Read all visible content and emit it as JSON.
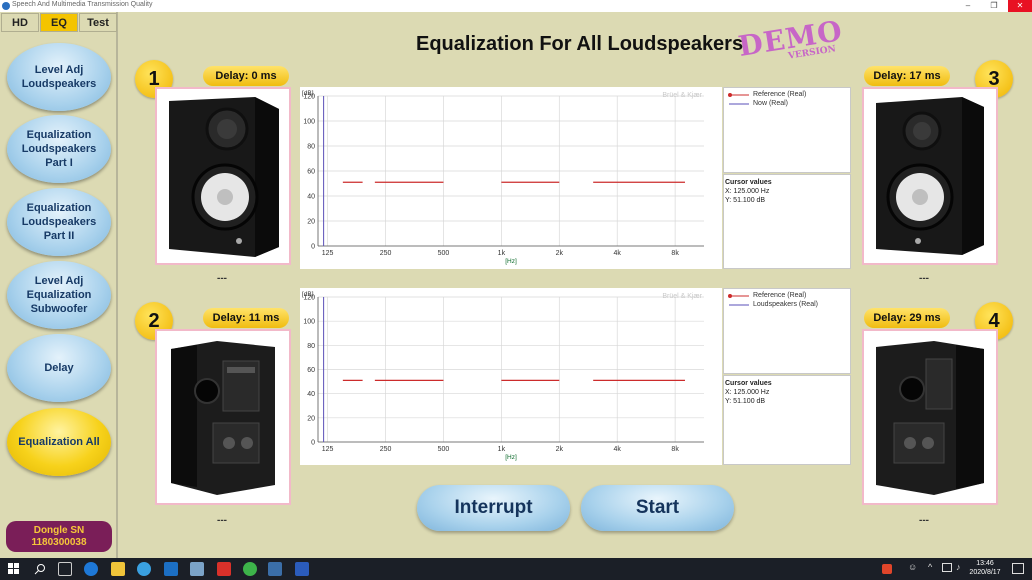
{
  "window": {
    "title": "Speech And Multimedia Transmission Quality",
    "min": "–",
    "max": "❐",
    "close": "✕"
  },
  "tabs": [
    {
      "label": "HD"
    },
    {
      "label": "EQ"
    },
    {
      "label": "Test"
    }
  ],
  "sidebar": {
    "items": [
      {
        "label": "Level Adj Loudspeakers"
      },
      {
        "label": "Equalization Loudspeakers Part I"
      },
      {
        "label": "Equalization Loudspeakers Part II"
      },
      {
        "label": "Level Adj Equalization Subwoofer"
      },
      {
        "label": "Delay"
      },
      {
        "label": "Equalization All",
        "active": true
      }
    ]
  },
  "dongle": {
    "label": "Dongle SN",
    "value": "1180300038"
  },
  "header": {
    "title": "Equalization For All Loudspeakers",
    "demo": "DEMO",
    "demo_sub": "VERSION"
  },
  "speakers": [
    {
      "num": "1",
      "delay": "Delay: 0 ms",
      "status": "---",
      "view": "front"
    },
    {
      "num": "2",
      "delay": "Delay: 11 ms",
      "status": "---",
      "view": "back"
    },
    {
      "num": "3",
      "delay": "Delay: 17 ms",
      "status": "---",
      "view": "front"
    },
    {
      "num": "4",
      "delay": "Delay: 29 ms",
      "status": "---",
      "view": "back"
    }
  ],
  "charts": [
    {
      "watermark": "Brüel & Kjær",
      "legend": [
        "Reference (Real)",
        "Now (Real)"
      ],
      "cursor_title": "Cursor values",
      "cursor_x": "X: 125.000 Hz",
      "cursor_y": "Y: 51.100 dB"
    },
    {
      "watermark": "Brüel & Kjær",
      "legend": [
        "Reference (Real)",
        "Loudspeakers (Real)"
      ],
      "cursor_title": "Cursor values",
      "cursor_x": "X: 125.000 Hz",
      "cursor_y": "Y: 51.100 dB"
    }
  ],
  "chart_data": [
    {
      "type": "line",
      "ylabel": "[dB]",
      "xlabel": "[Hz]",
      "ylim": [
        0,
        120
      ],
      "yticks": [
        0,
        20,
        40,
        60,
        80,
        100,
        120
      ],
      "xscale": "log",
      "xticks": [
        "125",
        "250",
        "500",
        "1k",
        "2k",
        "4k",
        "8k"
      ],
      "xtick_values": [
        125,
        250,
        500,
        1000,
        2000,
        4000,
        8000
      ],
      "grid": true,
      "legend_position": "right",
      "series": [
        {
          "name": "Reference (Real)",
          "color": "#cc2b2b",
          "segments": [
            [
              150,
              190,
              51
            ],
            [
              220,
              500,
              51
            ],
            [
              1000,
              2000,
              51
            ],
            [
              3000,
              9000,
              51
            ]
          ]
        },
        {
          "name": "Now (Real)",
          "color": "#5a4fb8",
          "segments": []
        }
      ],
      "cursor_x": 125
    },
    {
      "type": "line",
      "ylabel": "[dB]",
      "xlabel": "[Hz]",
      "ylim": [
        0,
        120
      ],
      "yticks": [
        0,
        20,
        40,
        60,
        80,
        100,
        120
      ],
      "xscale": "log",
      "xticks": [
        "125",
        "250",
        "500",
        "1k",
        "2k",
        "4k",
        "8k"
      ],
      "xtick_values": [
        125,
        250,
        500,
        1000,
        2000,
        4000,
        8000
      ],
      "grid": true,
      "legend_position": "right",
      "series": [
        {
          "name": "Reference (Real)",
          "color": "#cc2b2b",
          "segments": [
            [
              150,
              190,
              51
            ],
            [
              220,
              500,
              51
            ],
            [
              1000,
              2000,
              51
            ],
            [
              3000,
              9000,
              51
            ]
          ]
        },
        {
          "name": "Loudspeakers (Real)",
          "color": "#5a4fb8",
          "segments": []
        }
      ],
      "cursor_x": 125
    }
  ],
  "buttons": {
    "interrupt": "Interrupt",
    "start": "Start"
  },
  "taskbar": {
    "time": "13:46",
    "date": "2020/8/17"
  }
}
